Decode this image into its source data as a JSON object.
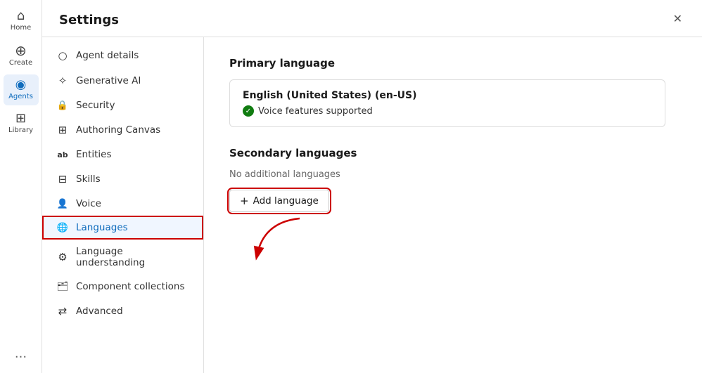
{
  "nav": {
    "items": [
      {
        "id": "home",
        "label": "Home",
        "icon": "⌂",
        "active": false
      },
      {
        "id": "create",
        "label": "Create",
        "icon": "+",
        "active": false
      },
      {
        "id": "agents",
        "label": "Agents",
        "icon": "◉",
        "active": true
      },
      {
        "id": "library",
        "label": "Library",
        "icon": "⊞",
        "active": false
      }
    ],
    "more_icon": "···"
  },
  "settings": {
    "title": "Settings",
    "close_label": "✕"
  },
  "sidebar": {
    "items": [
      {
        "id": "agent-details",
        "label": "Agent details",
        "icon": "○"
      },
      {
        "id": "generative-ai",
        "label": "Generative AI",
        "icon": "✧"
      },
      {
        "id": "security",
        "label": "Security",
        "icon": "🔒"
      },
      {
        "id": "authoring-canvas",
        "label": "Authoring Canvas",
        "icon": "⊞"
      },
      {
        "id": "entities",
        "label": "Entities",
        "icon": "ab"
      },
      {
        "id": "skills",
        "label": "Skills",
        "icon": "⊟"
      },
      {
        "id": "voice",
        "label": "Voice",
        "icon": "👤"
      },
      {
        "id": "languages",
        "label": "Languages",
        "icon": "🌐",
        "active": true
      },
      {
        "id": "language-understanding",
        "label": "Language understanding",
        "icon": "⚙"
      },
      {
        "id": "component-collections",
        "label": "Component collections",
        "icon": "🗂"
      },
      {
        "id": "advanced",
        "label": "Advanced",
        "icon": "⇄"
      }
    ]
  },
  "main": {
    "primary_language": {
      "section_title": "Primary language",
      "language_name": "English (United States) (en-US)",
      "voice_label": "Voice features supported"
    },
    "secondary_languages": {
      "section_title": "Secondary languages",
      "no_langs_label": "No additional languages",
      "add_btn_label": "Add language",
      "add_btn_icon": "+"
    }
  }
}
